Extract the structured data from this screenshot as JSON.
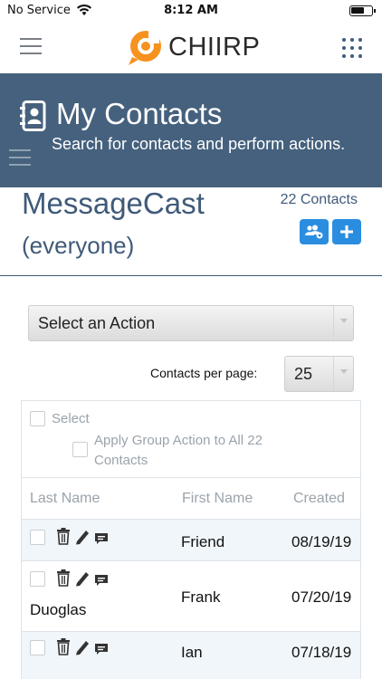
{
  "status_bar": {
    "carrier": "No Service",
    "time": "8:12 AM"
  },
  "app": {
    "logo_text": "CHIIRP",
    "brand_color": "#f6921e"
  },
  "header": {
    "title": "My Contacts",
    "subtitle": "Search for contacts and perform actions.",
    "background_color": "#45617d"
  },
  "list": {
    "name": "MessageCast",
    "audience": "(everyone)",
    "count": "22 Contacts"
  },
  "actions": {
    "select_placeholder": "Select an Action",
    "per_page_label": "Contacts per page:",
    "per_page_value": "25"
  },
  "table": {
    "select_label": "Select",
    "apply_all_label": "Apply Group Action to All 22 Contacts",
    "columns": {
      "last_name": "Last Name",
      "first_name": "First Name",
      "created": "Created"
    },
    "rows": [
      {
        "last_name": "",
        "first_name": "Friend",
        "created": "08/19/19"
      },
      {
        "last_name": "Duoglas",
        "first_name": "Frank",
        "created": "07/20/19"
      },
      {
        "last_name": "",
        "first_name": "Ian",
        "created": "07/18/19"
      }
    ]
  },
  "icons": {
    "menu": "hamburger-menu-icon",
    "apps": "grid-dots-icon",
    "contacts": "contact-book-icon",
    "group_settings": "users-gear-icon",
    "add": "plus-icon",
    "delete": "trash-icon",
    "edit": "pencil-icon",
    "message": "chat-bubble-icon"
  },
  "accent_color": "#2b8de0"
}
